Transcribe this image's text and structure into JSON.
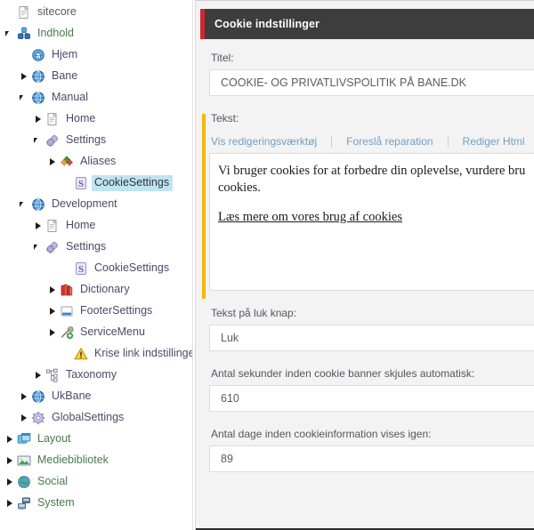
{
  "tree": {
    "root": {
      "label": "sitecore",
      "icon": "document-icon"
    },
    "items": [
      {
        "label": "sitecore",
        "icon": "document-icon",
        "depth": 0,
        "expander": "none",
        "style": "gray"
      },
      {
        "label": "Indhold",
        "icon": "content-cubes-icon",
        "depth": 0,
        "expander": "open",
        "style": "green"
      },
      {
        "label": "Hjem",
        "icon": "home-globe-icon",
        "depth": 1,
        "expander": "none",
        "style": "normal"
      },
      {
        "label": "Bane",
        "icon": "globe-icon",
        "depth": 1,
        "expander": "closed",
        "style": "normal"
      },
      {
        "label": "Manual",
        "icon": "globe-icon",
        "depth": 1,
        "expander": "open",
        "style": "normal"
      },
      {
        "label": "Home",
        "icon": "document-icon",
        "depth": 2,
        "expander": "closed",
        "style": "normal"
      },
      {
        "label": "Settings",
        "icon": "gears-icon",
        "depth": 2,
        "expander": "open",
        "style": "normal"
      },
      {
        "label": "Aliases",
        "icon": "alias-arrows-icon",
        "depth": 3,
        "expander": "closed",
        "style": "normal"
      },
      {
        "label": "CookieSettings",
        "icon": "cookie-s-icon",
        "depth": 4,
        "expander": "none",
        "style": "selected"
      },
      {
        "label": "Development",
        "icon": "globe-icon",
        "depth": 1,
        "expander": "open",
        "style": "normal"
      },
      {
        "label": "Home",
        "icon": "document-icon",
        "depth": 2,
        "expander": "closed",
        "style": "normal"
      },
      {
        "label": "Settings",
        "icon": "gears-icon",
        "depth": 2,
        "expander": "open",
        "style": "normal"
      },
      {
        "label": "CookieSettings",
        "icon": "cookie-s-icon",
        "depth": 4,
        "expander": "none",
        "style": "normal"
      },
      {
        "label": "Dictionary",
        "icon": "books-icon",
        "depth": 3,
        "expander": "closed",
        "style": "normal"
      },
      {
        "label": "FooterSettings",
        "icon": "footer-window-icon",
        "depth": 3,
        "expander": "closed",
        "style": "normal"
      },
      {
        "label": "ServiceMenu",
        "icon": "service-menu-icon",
        "depth": 3,
        "expander": "closed",
        "style": "normal"
      },
      {
        "label": "Krise link indstillinger",
        "icon": "warning-icon",
        "depth": 4,
        "expander": "none",
        "style": "normal"
      },
      {
        "label": "Taxonomy",
        "icon": "taxonomy-icon",
        "depth": 2,
        "expander": "closed",
        "style": "normal"
      },
      {
        "label": "UkBane",
        "icon": "globe-icon",
        "depth": 1,
        "expander": "closed",
        "style": "normal"
      },
      {
        "label": "GlobalSettings",
        "icon": "settings-gear-icon",
        "depth": 1,
        "expander": "closed",
        "style": "normal"
      },
      {
        "label": "Layout",
        "icon": "layout-icon",
        "depth": 0,
        "expander": "closed",
        "style": "green"
      },
      {
        "label": "Mediebibliotek",
        "icon": "media-image-icon",
        "depth": 0,
        "expander": "closed",
        "style": "green"
      },
      {
        "label": "Social",
        "icon": "social-globe-icon",
        "depth": 0,
        "expander": "closed",
        "style": "green"
      },
      {
        "label": "System",
        "icon": "system-icon",
        "depth": 0,
        "expander": "closed",
        "style": "green"
      }
    ]
  },
  "panel": {
    "header_title": "Cookie indstillinger",
    "accent_color": "#d1262c",
    "header_bg": "#3d3d3d",
    "gutter_color": "#f5b611"
  },
  "fields": {
    "title": {
      "label": "Titel:",
      "value": "COOKIE- OG PRIVATLIVSPOLITIK PÅ BANE.DK"
    },
    "text": {
      "label": "Tekst:",
      "toolbar": [
        {
          "label": "Vis redigeringsværktøj"
        },
        {
          "label": "Foreslå reparation"
        },
        {
          "label": "Rediger Html"
        }
      ],
      "paragraph1": "Vi bruger cookies for at forbedre din oplevelse, vurdere bru",
      "paragraph1_line2": "cookies.",
      "link_text": "Læs mere om vores brug af cookies"
    },
    "close_button_text": {
      "label": "Tekst på luk knap:",
      "value": "Luk"
    },
    "auto_hide_seconds": {
      "label": "Antal sekunder inden cookie banner skjules automatisk:",
      "value": "610"
    },
    "days_until_shown_again": {
      "label": "Antal dage inden cookieinformation vises igen:",
      "value": "89"
    }
  }
}
